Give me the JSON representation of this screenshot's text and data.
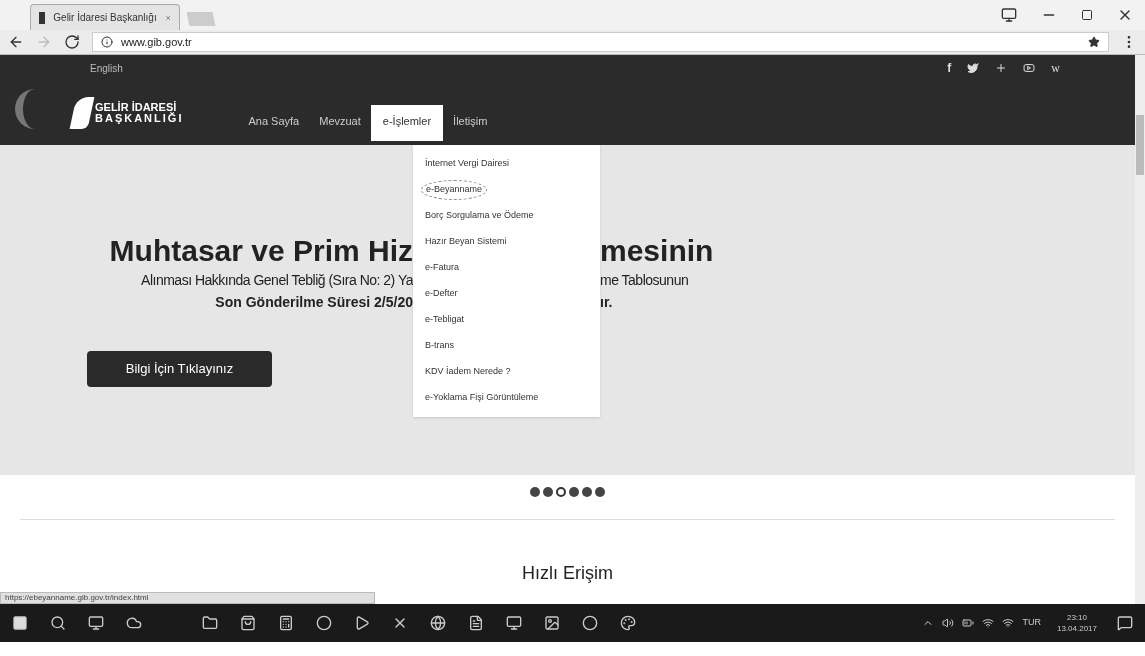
{
  "browser": {
    "tab_title": "Gelir İdaresi Başkanlığı",
    "url": "www.gib.gov.tr",
    "status_url": "https://ebeyanname.gib.gov.tr/index.html"
  },
  "header": {
    "language_link": "English",
    "logo_line1": "GELİR İDARESİ",
    "logo_line2": "BAŞKANLIĞI",
    "social": [
      "f",
      "w"
    ],
    "nav": [
      {
        "label": "Ana Sayfa",
        "selected": false
      },
      {
        "label": "Mevzuat",
        "selected": false
      },
      {
        "label": "e-İşlemler",
        "selected": true
      },
      {
        "label": "İletişim",
        "selected": false
      }
    ]
  },
  "menu": [
    {
      "label": "İnternet Vergi Dairesi",
      "circled": false
    },
    {
      "label": "e-Beyanname",
      "circled": true
    },
    {
      "label": "Borç Sorgulama ve Ödeme",
      "circled": false
    },
    {
      "label": "Hazır Beyan Sistemi",
      "circled": false
    },
    {
      "label": "e-Fatura",
      "circled": false
    },
    {
      "label": "e-Defter",
      "circled": false
    },
    {
      "label": "e-Tebligat",
      "circled": false
    },
    {
      "label": "B-trans",
      "circled": false
    },
    {
      "label": "KDV İadem Nerede ?",
      "circled": false
    },
    {
      "label": "e-Yoklama Fişi Görüntüleme",
      "circled": false
    }
  ],
  "hero": {
    "lines": [
      {
        "left": "Muhtasar ve Prim Hiz",
        "right": "mesinin",
        "kind": "title"
      },
      {
        "left": "Alınması Hakkında Genel Tebliğ (Sıra No: 2) Ya",
        "right": "me Tablosunun",
        "kind": "text"
      },
      {
        "left": "Son Gönderilme Süresi 2/5/20",
        "right": "ır.",
        "kind": "bold"
      }
    ],
    "button": "Bilgi İçin Tıklayınız",
    "dots": [
      {
        "selected": false
      },
      {
        "selected": false
      },
      {
        "selected": true
      },
      {
        "selected": false
      },
      {
        "selected": false
      },
      {
        "selected": false
      }
    ]
  },
  "quick_access_title": "Hızlı Erişim",
  "taskbar": {
    "language": "TUR",
    "time": "23:10",
    "date": "13.04.2017"
  }
}
